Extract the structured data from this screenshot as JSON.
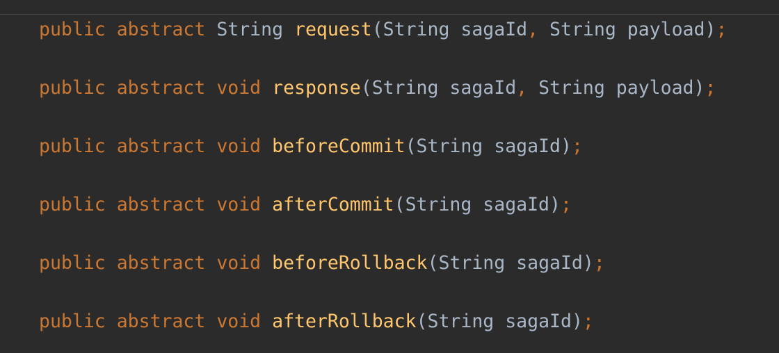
{
  "editor": {
    "colors": {
      "background": "#2b2b2b",
      "keyword": "#cc7832",
      "method_name": "#ffc66d",
      "plain": "#a9b7c6"
    },
    "lines": [
      {
        "modifier1": "public",
        "modifier2": "abstract",
        "return_type": "String",
        "method": "request",
        "open_paren": "(",
        "params": [
          {
            "type": "String",
            "name": "sagaId"
          },
          {
            "type": "String",
            "name": "payload"
          }
        ],
        "close": ")",
        "terminator": ";"
      },
      {
        "modifier1": "public",
        "modifier2": "abstract",
        "return_type": "void",
        "method": "response",
        "open_paren": "(",
        "params": [
          {
            "type": "String",
            "name": "sagaId"
          },
          {
            "type": "String",
            "name": "payload"
          }
        ],
        "close": ")",
        "terminator": ";"
      },
      {
        "modifier1": "public",
        "modifier2": "abstract",
        "return_type": "void",
        "method": "beforeCommit",
        "open_paren": "(",
        "params": [
          {
            "type": "String",
            "name": "sagaId"
          }
        ],
        "close": ")",
        "terminator": ";"
      },
      {
        "modifier1": "public",
        "modifier2": "abstract",
        "return_type": "void",
        "method": "afterCommit",
        "open_paren": "(",
        "params": [
          {
            "type": "String",
            "name": "sagaId"
          }
        ],
        "close": ")",
        "terminator": ";"
      },
      {
        "modifier1": "public",
        "modifier2": "abstract",
        "return_type": "void",
        "method": "beforeRollback",
        "open_paren": "(",
        "params": [
          {
            "type": "String",
            "name": "sagaId"
          }
        ],
        "close": ")",
        "terminator": ";"
      },
      {
        "modifier1": "public",
        "modifier2": "abstract",
        "return_type": "void",
        "method": "afterRollback",
        "open_paren": "(",
        "params": [
          {
            "type": "String",
            "name": "sagaId"
          }
        ],
        "close": ")",
        "terminator": ";"
      }
    ]
  }
}
